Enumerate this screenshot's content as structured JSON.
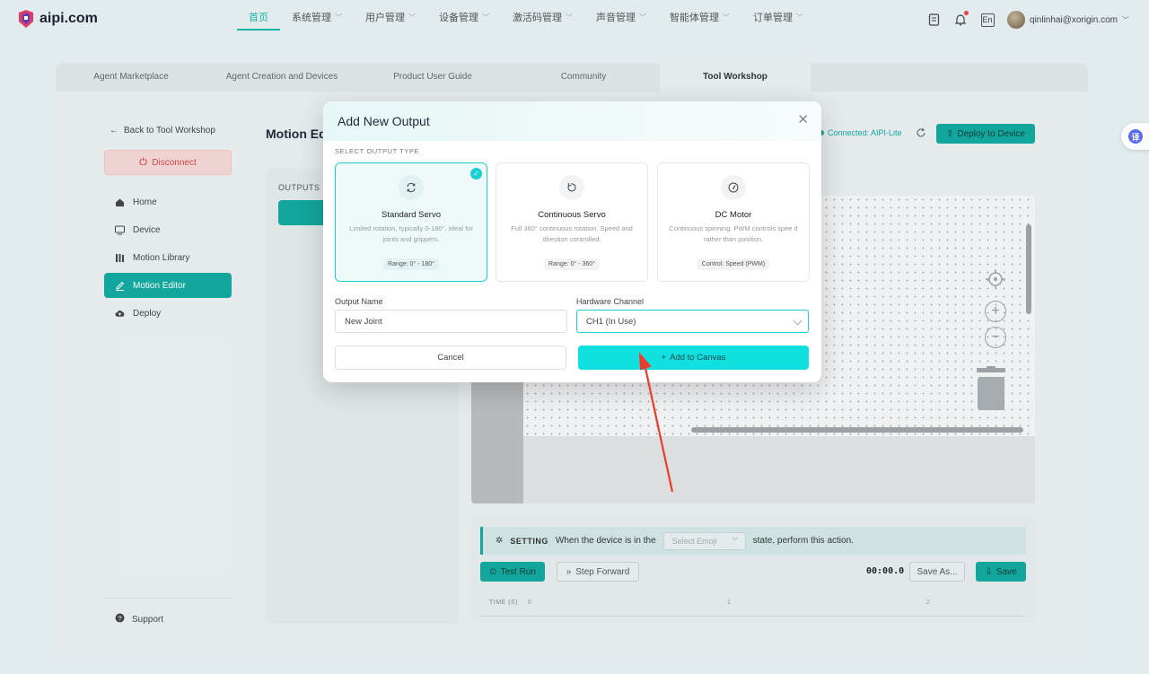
{
  "brand": {
    "name": "aipi.com"
  },
  "nav": {
    "items": [
      {
        "label": "首页",
        "active": true,
        "dropdown": false
      },
      {
        "label": "系统管理",
        "active": false,
        "dropdown": true
      },
      {
        "label": "用户管理",
        "active": false,
        "dropdown": true
      },
      {
        "label": "设备管理",
        "active": false,
        "dropdown": true
      },
      {
        "label": "激活码管理",
        "active": false,
        "dropdown": true
      },
      {
        "label": "声音管理",
        "active": false,
        "dropdown": true
      },
      {
        "label": "智能体管理",
        "active": false,
        "dropdown": true
      },
      {
        "label": "订单管理",
        "active": false,
        "dropdown": true
      }
    ],
    "language": "En",
    "user_email": "qinlinhai@xorigin.com"
  },
  "tabs": [
    "Agent Marketplace",
    "Agent Creation and Devices",
    "Product User Guide",
    "Community",
    "Tool Workshop"
  ],
  "sidebar": {
    "back_label": "Back to Tool Workshop",
    "disconnect_label": "Disconnect",
    "items": [
      {
        "label": "Home",
        "icon": "home-icon"
      },
      {
        "label": "Device",
        "icon": "monitor-icon"
      },
      {
        "label": "Motion Library",
        "icon": "library-icon"
      },
      {
        "label": "Motion Editor",
        "icon": "pen-icon",
        "active": true
      },
      {
        "label": "Deploy",
        "icon": "cloud-upload-icon"
      }
    ],
    "support_label": "Support"
  },
  "editor": {
    "title": "Motion Edi",
    "outputs_label": "OUTPUTS",
    "connected_label": "Connected: AIPI-Lite",
    "deploy_label": "Deploy to Device"
  },
  "settings": {
    "label": "SETTING",
    "prefix": "When the device is in the",
    "emoji_placeholder": "Select Emoji",
    "suffix": "state, perform this action.",
    "test_run": "Test Run",
    "step_forward": "Step Forward",
    "timer": "00:00.0",
    "save_as": "Save As...",
    "save": "Save",
    "time_label": "TIME (S)",
    "ticks": [
      "0",
      "1",
      "2"
    ]
  },
  "modal": {
    "title": "Add New Output",
    "section_label": "SELECT OUTPUT TYPE",
    "types": [
      {
        "title": "Standard Servo",
        "desc": "Limited rotation, typically 0-180°. Ideal for joints and grippers.",
        "range": "Range: 0° - 180°",
        "selected": true,
        "icon": "rotate-icon"
      },
      {
        "title": "Continuous Servo",
        "desc": "Full 360° continuous rotation. Speed and direction controlled.",
        "range": "Range: 0° - 360°",
        "selected": false,
        "icon": "rotate-ccw-icon"
      },
      {
        "title": "DC Motor",
        "desc": "Continuous spinning. PWM controls spee d rather than position.",
        "range": "Control: Speed (PWM)",
        "selected": false,
        "icon": "gauge-icon"
      }
    ],
    "output_name_label": "Output Name",
    "output_name_value": "New Joint",
    "hardware_channel_label": "Hardware Channel",
    "hardware_channel_value": "CH1 (In Use)",
    "cancel_label": "Cancel",
    "add_label": "Add to Canvas"
  },
  "colors": {
    "accent": "#13a89e",
    "accent_bright": "#10e0e0",
    "danger": "#d94646",
    "annotation_arrow": "#ef3b2d"
  }
}
